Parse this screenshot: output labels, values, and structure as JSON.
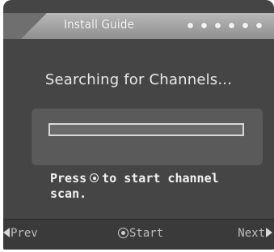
{
  "header": {
    "title": "Install Guide",
    "step_indicator_count": 6
  },
  "main": {
    "heading": "Searching for Channels...",
    "progress": 0,
    "instruction_before": "Press",
    "instruction_after": "to start channel\nscan.",
    "instruction_icon": "ok-button-icon"
  },
  "footer": {
    "prev_label": "Prev",
    "start_label": "Start",
    "next_label": "Next",
    "prev_icon": "triangle-left-icon",
    "start_icon": "ok-button-icon",
    "next_icon": "triangle-right-icon"
  },
  "colors": {
    "panel": "#454545",
    "titlebar": "#a6a6a6",
    "text": "#e8e8e8",
    "footer": "#3a3a3a"
  }
}
